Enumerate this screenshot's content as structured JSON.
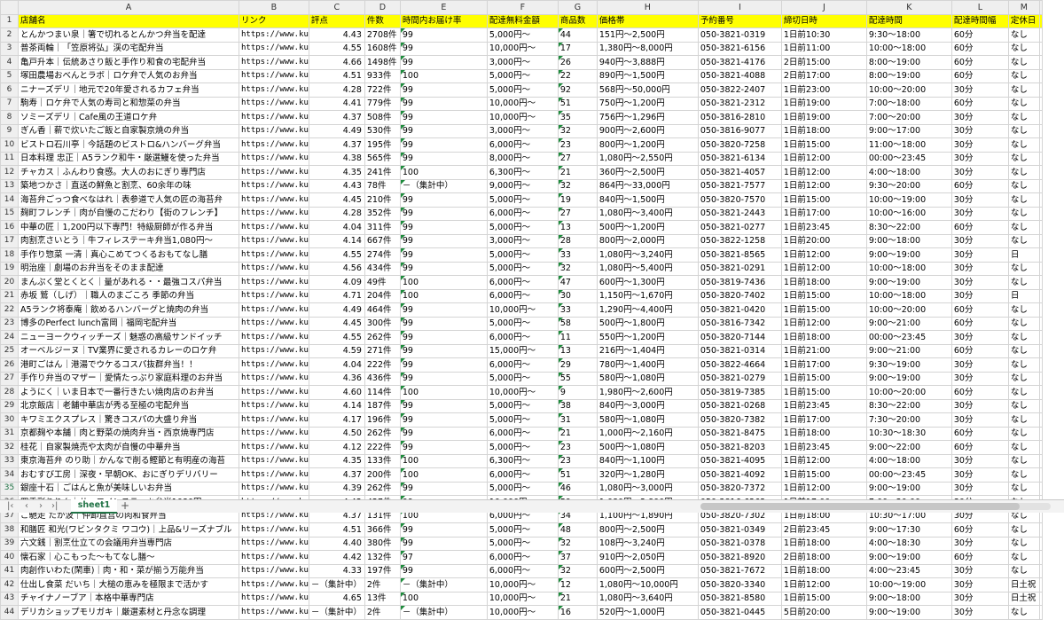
{
  "columns": [
    "A",
    "B",
    "C",
    "D",
    "E",
    "F",
    "G",
    "H",
    "I",
    "J",
    "K",
    "L",
    "M"
  ],
  "row_numbers": [
    "1",
    "2",
    "3",
    "4",
    "5",
    "6",
    "7",
    "8",
    "9",
    "10",
    "11",
    "12",
    "13",
    "14",
    "15",
    "16",
    "17",
    "18",
    "19",
    "20",
    "21",
    "22",
    "23",
    "24",
    "25",
    "26",
    "27",
    "28",
    "29",
    "30",
    "31",
    "32",
    "33",
    "34",
    "35",
    "36",
    "37",
    "38",
    "39",
    "40",
    "41",
    "42",
    "43",
    "44"
  ],
  "selected_row": "35",
  "header": [
    "店舗名",
    "リンク",
    "評点",
    "件数",
    "時間内お届け率",
    "配達無料金額",
    "商品数",
    "価格帯",
    "予約番号",
    "締切日時",
    "配達時間",
    "配達時間幅",
    "定休日"
  ],
  "rows": [
    [
      "とんかつまい泉｜箸で切れるとんかつ弁当を配達",
      "https://www.ku",
      "4.43",
      "2708件",
      "99",
      "5,000円～",
      "44",
      "151円～2,500円",
      "050-3821-0319",
      "1日前10:30",
      "9:30～18:00",
      "60分",
      "なし"
    ],
    [
      "普茶両輪｜「笠原将弘」渓の宅配弁当",
      "https://www.ku",
      "4.55",
      "1608件",
      "99",
      "10,000円～",
      "17",
      "1,380円～8,000円",
      "050-3821-6156",
      "1日前11:00",
      "10:00～18:00",
      "60分",
      "なし"
    ],
    [
      "亀戸升本｜伝統あさり飯と手作り和食の宅配弁当",
      "https://www.ku",
      "4.66",
      "1498件",
      "99",
      "3,000円～",
      "26",
      "940円～3,888円",
      "050-3821-4176",
      "2日前15:00",
      "8:00～19:00",
      "60分",
      "なし"
    ],
    [
      "塚田農場おべんとラボ｜ロケ弁で人気のお弁当",
      "https://www.ku",
      "4.51",
      "933件",
      "100",
      "5,000円～",
      "22",
      "890円～1,500円",
      "050-3821-4088",
      "2日前17:00",
      "8:00～19:00",
      "60分",
      "なし"
    ],
    [
      "ニナーズデリ｜地元で20年愛されるカフェ弁当",
      "https://www.ku",
      "4.28",
      "722件",
      "99",
      "5,000円～",
      "92",
      "568円～50,000円",
      "050-3822-2407",
      "1日前23:00",
      "10:00～20:00",
      "30分",
      "なし"
    ],
    [
      "駒寿｜ロケ弁で人気の寿司と和惣菜の弁当",
      "https://www.ku",
      "4.41",
      "779件",
      "99",
      "10,000円～",
      "51",
      "750円～1,200円",
      "050-3821-2312",
      "1日前19:00",
      "7:00～18:00",
      "60分",
      "なし"
    ],
    [
      "ソミーズデリ｜Cafe風の王道ロケ弁",
      "https://www.ku",
      "4.37",
      "508件",
      "99",
      "10,000円～",
      "35",
      "756円～1,296円",
      "050-3816-2810",
      "1日前19:00",
      "7:00～20:00",
      "30分",
      "なし"
    ],
    [
      "ぎん香｜薪で炊いたご飯と自家製京焼の弁当",
      "https://www.ku",
      "4.49",
      "530件",
      "99",
      "3,000円～",
      "32",
      "900円～2,600円",
      "050-3816-9077",
      "1日前18:00",
      "9:00～17:00",
      "30分",
      "なし"
    ],
    [
      "ビストロ石川亭｜今話題のビストロ&ハンバーグ弁当",
      "https://www.ku",
      "4.37",
      "195件",
      "99",
      "6,000円～",
      "23",
      "800円～1,200円",
      "050-3820-7258",
      "1日前15:00",
      "11:00～18:00",
      "30分",
      "なし"
    ],
    [
      "日本料理 忠正｜A5ランク和牛・厳選鰻を使った弁当",
      "https://www.ku",
      "4.38",
      "565件",
      "99",
      "8,000円～",
      "27",
      "1,080円～2,550円",
      "050-3821-6134",
      "1日前12:00",
      "00:00～23:45",
      "30分",
      "なし"
    ],
    [
      "チャカス｜ふんわり食感。大人のおにぎり専門店",
      "https://www.ku",
      "4.35",
      "241件",
      "100",
      "6,300円～",
      "21",
      "360円～2,500円",
      "050-3821-4057",
      "1日前12:00",
      "4:00～18:00",
      "30分",
      "なし"
    ],
    [
      "築地つかさ｜直送の鮮魚と割烹、60余年の味",
      "https://www.ku",
      "4.43",
      "78件",
      "－（集計中）",
      "9,000円～",
      "32",
      "864円～33,000円",
      "050-3821-7577",
      "1日前12:00",
      "9:30～20:00",
      "60分",
      "なし"
    ],
    [
      "海苔弁ごっつ食べなはれ｜表参道で人気の匠の海苔弁",
      "https://www.ku",
      "4.45",
      "210件",
      "99",
      "5,000円～",
      "19",
      "840円～1,500円",
      "050-3820-7570",
      "1日前15:00",
      "10:00～19:00",
      "30分",
      "なし"
    ],
    [
      "麹町フレンチ｜肉が自慢のこだわり【街のフレンチ】",
      "https://www.ku",
      "4.28",
      "352件",
      "99",
      "6,000円～",
      "27",
      "1,080円～3,400円",
      "050-3821-2443",
      "1日前17:00",
      "10:00～16:00",
      "30分",
      "なし"
    ],
    [
      "中華の匠｜1,200円以下専門！特級厨師が作る弁当",
      "https://www.ku",
      "4.04",
      "311件",
      "99",
      "5,000円～",
      "13",
      "500円～1,200円",
      "050-3821-0277",
      "1日前23:45",
      "8:30～22:00",
      "60分",
      "なし"
    ],
    [
      "肉割烹さいとう｜牛フィレステーキ弁当1,080円～",
      "https://www.ku",
      "4.14",
      "667件",
      "99",
      "3,000円～",
      "28",
      "800円～2,000円",
      "050-3822-1258",
      "1日前20:00",
      "9:00～18:00",
      "30分",
      "なし"
    ],
    [
      "手作り惣菜 一清｜真心こめてつくるおもてなし膳",
      "https://www.ku",
      "4.55",
      "274件",
      "99",
      "5,000円～",
      "33",
      "1,080円～3,240円",
      "050-3821-8565",
      "1日前12:00",
      "9:00～19:00",
      "30分",
      "日"
    ],
    [
      "明治座｜劇場のお弁当をそのまま配達",
      "https://www.ku",
      "4.56",
      "434件",
      "99",
      "5,000円～",
      "32",
      "1,080円～5,400円",
      "050-3821-0291",
      "1日前12:00",
      "10:00～18:00",
      "30分",
      "なし"
    ],
    [
      "まんぷく堂とくとく｜量があれる・・最強コスパ弁当",
      "https://www.ku",
      "4.09",
      "49件",
      "100",
      "6,000円～",
      "47",
      "600円～1,300円",
      "050-3819-7436",
      "1日前18:00",
      "9:00～19:00",
      "30分",
      "なし"
    ],
    [
      "赤坂 鷲（しげ）｜職人のまごころ 季節の弁当",
      "https://www.ku",
      "4.71",
      "204件",
      "100",
      "6,000円～",
      "30",
      "1,150円～1,670円",
      "050-3820-7402",
      "1日前15:00",
      "10:00～18:00",
      "30分",
      "日"
    ],
    [
      "A5ランク将泰庵｜飲めるハンバーグと焼肉の弁当",
      "https://www.ku",
      "4.49",
      "464件",
      "99",
      "10,000円～",
      "33",
      "1,290円～4,400円",
      "050-3821-0420",
      "1日前15:00",
      "10:00～20:00",
      "60分",
      "なし"
    ],
    [
      "博多のPerfect lunch富岡｜福岡宅配弁当",
      "https://www.ku",
      "4.45",
      "300件",
      "99",
      "5,000円～",
      "58",
      "500円～1,800円",
      "050-3816-7342",
      "1日前12:00",
      "9:00～21:00",
      "60分",
      "なし"
    ],
    [
      "ニューヨークウィッチーズ｜魅惑の高級サンドイッチ",
      "https://www.ku",
      "4.55",
      "262件",
      "99",
      "6,000円～",
      "11",
      "550円～1,200円",
      "050-3820-7144",
      "1日前18:00",
      "00:00～23:45",
      "30分",
      "なし"
    ],
    [
      "オーベルジーヌ｜TV業界に愛されるカレーのロケ弁",
      "https://www.ku",
      "4.59",
      "271件",
      "99",
      "15,000円～",
      "13",
      "216円～1,404円",
      "050-3821-0314",
      "1日前21:00",
      "9:00～21:00",
      "60分",
      "なし"
    ],
    [
      "港町ごはん｜港湯でウケるコスパ抜群弁当！！",
      "https://www.ku",
      "4.04",
      "222件",
      "99",
      "6,000円～",
      "29",
      "780円～1,400円",
      "050-3822-4664",
      "1日前17:00",
      "9:30～19:00",
      "30分",
      "なし"
    ],
    [
      "手作り弁当のマザー｜愛情たっぷり家庭料理のお弁当",
      "https://www.ku",
      "4.36",
      "436件",
      "99",
      "5,000円～",
      "55",
      "580円～1,080円",
      "050-3821-0279",
      "1日前15:00",
      "9:00～19:00",
      "30分",
      "なし"
    ],
    [
      "ようにく｜いま日本で一番行きたい焼肉店のお弁当",
      "https://www.ku",
      "4.60",
      "114件",
      "100",
      "10,000円～",
      "9",
      "1,980円～2,600円",
      "050-3819-7385",
      "1日前15:00",
      "10:00～20:00",
      "60分",
      "なし"
    ],
    [
      "北京飯店｜老舗中華店が秀る至極の宅配弁当",
      "https://www.ku",
      "4.14",
      "187件",
      "99",
      "5,000円～",
      "38",
      "840円～3,000円",
      "050-3821-0268",
      "1日前23:45",
      "8:30～22:00",
      "30分",
      "なし"
    ],
    [
      "キワミエクスプレス｜驚きコスパの大盛り弁当",
      "https://www.ku",
      "4.17",
      "196件",
      "99",
      "5,000円～",
      "31",
      "580円～1,080円",
      "050-3820-7382",
      "1日前17:00",
      "7:30～20:00",
      "30分",
      "なし"
    ],
    [
      "京都麹や本舗｜肉と野菜の焼肉弁当・西京焼専門店",
      "https://www.ku",
      "4.50",
      "262件",
      "99",
      "6,000円～",
      "21",
      "1,000円～2,160円",
      "050-3821-8475",
      "1日前18:00",
      "10:30～18:30",
      "60分",
      "なし"
    ],
    [
      "桂花｜自家製焼売や太肉が自慢の中華弁当",
      "https://www.ku",
      "4.12",
      "222件",
      "99",
      "5,000円～",
      "23",
      "500円～1,080円",
      "050-3821-8203",
      "1日前23:45",
      "9:00～22:00",
      "60分",
      "なし"
    ],
    [
      "東京海苔弁 のり助｜かんなで削る鰹節と有明産の海苔",
      "https://www.ku",
      "4.35",
      "133件",
      "100",
      "6,300円～",
      "23",
      "840円～1,100円",
      "050-3821-4095",
      "1日前12:00",
      "4:00～18:00",
      "30分",
      "なし"
    ],
    [
      "おむすび工房｜深夜・早朝OK、おにぎりデリバリー",
      "https://www.ku",
      "4.37",
      "200件",
      "100",
      "6,000円～",
      "51",
      "320円～1,280円",
      "050-3821-4092",
      "1日前15:00",
      "00:00～23:45",
      "30分",
      "なし"
    ],
    [
      "銀座十石｜ごはんと魚が美味しいお弁当",
      "https://www.ku",
      "4.39",
      "262件",
      "99",
      "5,000円～",
      "46",
      "1,080円～3,000円",
      "050-3820-7372",
      "1日前12:00",
      "9:00～19:00",
      "30分",
      "なし"
    ],
    [
      "四季彩りりん｜サーロインステーキ弁当1080円～",
      "https://www.ku",
      "4.42",
      "427件",
      "99",
      "10,000円～",
      "59",
      "1,080円～2,800円",
      "050-3816-6263",
      "1日前17:00",
      "7:00～20:00",
      "30分",
      "なし"
    ],
    [
      "ご馳走 たか波｜仲卸直営の肉和食弁当",
      "https://www.ku",
      "4.37",
      "131件",
      "100",
      "6,000円～",
      "34",
      "1,100円～1,890円",
      "050-3820-7302",
      "1日前18:00",
      "10:30～17:00",
      "30分",
      "なし"
    ],
    [
      "和膳匠 和光(ワビンタクミ ワコウ)｜上品&リーズナブル",
      "https://www.ku",
      "4.51",
      "366件",
      "99",
      "5,000円～",
      "48",
      "800円～2,500円",
      "050-3821-0349",
      "2日前23:45",
      "9:00～17:30",
      "60分",
      "なし"
    ],
    [
      "六文銭｜割烹仕立ての会議用弁当専門店",
      "https://www.ku",
      "4.40",
      "380件",
      "99",
      "5,000円～",
      "32",
      "108円～3,240円",
      "050-3821-0378",
      "1日前18:00",
      "4:00～18:30",
      "30分",
      "なし"
    ],
    [
      "懐石家｜心こもった～もてなし膳～",
      "https://www.ku",
      "4.42",
      "132件",
      "97",
      "6,000円～",
      "37",
      "910円～2,050円",
      "050-3821-8920",
      "2日前18:00",
      "9:00～19:00",
      "60分",
      "なし"
    ],
    [
      "肉創作いわた(閑車)｜肉・和・菜が揃う万能弁当",
      "https://www.ku",
      "4.33",
      "197件",
      "99",
      "6,000円～",
      "32",
      "600円～2,500円",
      "050-3821-7672",
      "1日前18:00",
      "4:00～23:45",
      "30分",
      "なし"
    ],
    [
      "仕出し食菜 だいち｜大槌の恵みを極限まで活かす",
      "https://www.ku",
      "－（集計中）",
      "2件",
      "－（集計中）",
      "10,000円～",
      "12",
      "1,080円～10,000円",
      "050-3820-3340",
      "1日前12:00",
      "10:00～19:00",
      "30分",
      "日土祝"
    ],
    [
      "チャイナノーブア｜本格中華専門店",
      "https://www.ku",
      "4.65",
      "13件",
      "100",
      "10,000円～",
      "21",
      "1,080円～3,640円",
      "050-3821-8580",
      "1日前15:00",
      "9:00～18:00",
      "30分",
      "日土祝"
    ],
    [
      "デリカショップモリガキ｜厳選素材と丹念な調理",
      "https://www.ku",
      "－（集計中）",
      "2件",
      "－（集計中）",
      "10,000円～",
      "16",
      "520円～1,000円",
      "050-3821-0445",
      "5日前20:00",
      "9:00～19:00",
      "30分",
      "なし"
    ]
  ],
  "sheet_tabs": [
    "sheet1"
  ],
  "nav": {
    "prev": "‹",
    "next": "›",
    "first": "|‹",
    "last": "›|",
    "add": "+"
  }
}
